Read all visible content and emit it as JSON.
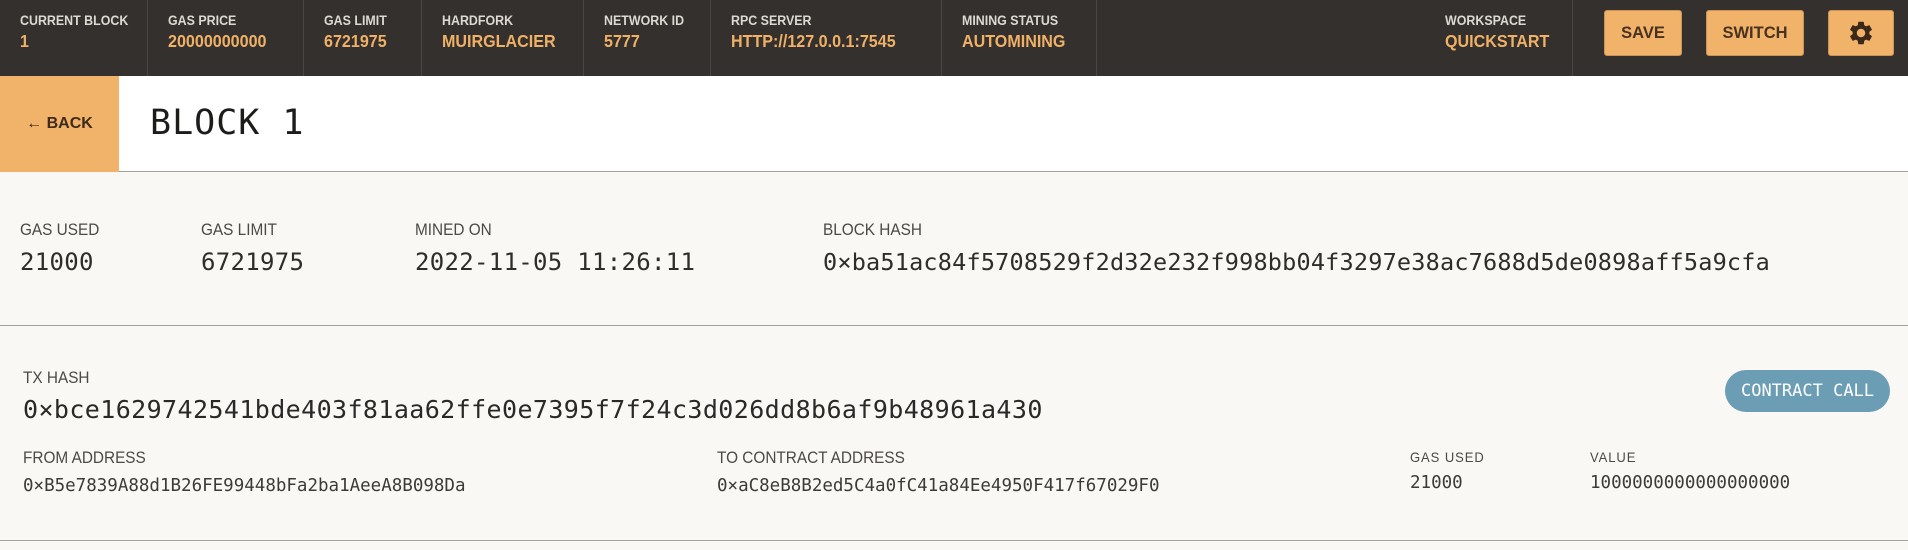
{
  "topbar": {
    "stats": [
      {
        "label": "CURRENT BLOCK",
        "value": "1"
      },
      {
        "label": "GAS PRICE",
        "value": "20000000000"
      },
      {
        "label": "GAS LIMIT",
        "value": "6721975"
      },
      {
        "label": "HARDFORK",
        "value": "MUIRGLACIER"
      },
      {
        "label": "NETWORK ID",
        "value": "5777"
      },
      {
        "label": "RPC SERVER",
        "value": "HTTP://127.0.0.1:7545"
      },
      {
        "label": "MINING STATUS",
        "value": "AUTOMINING"
      }
    ],
    "workspace": {
      "label": "WORKSPACE",
      "value": "QUICKSTART"
    },
    "save_label": "SAVE",
    "switch_label": "SWITCH",
    "settings_icon": "gear-icon"
  },
  "header": {
    "back_label": "← BACK",
    "title": "BLOCK 1"
  },
  "block": {
    "gas_used": {
      "label": "GAS USED",
      "value": "21000"
    },
    "gas_limit": {
      "label": "GAS LIMIT",
      "value": "6721975"
    },
    "mined_on": {
      "label": "MINED ON",
      "value": "2022-11-05 11:26:11"
    },
    "block_hash": {
      "label": "BLOCK HASH",
      "value": "0×ba51ac84f5708529f2d32e232f998bb04f3297e38ac7688d5de0898aff5a9cfa"
    }
  },
  "transaction": {
    "tx_hash_label": "TX HASH",
    "tx_hash": "0×bce1629742541bde403f81aa62ffe0e7395f7f24c3d026dd8b6af9b48961a430",
    "type_badge": "CONTRACT CALL",
    "from": {
      "label": "FROM ADDRESS",
      "value": "0×B5e7839A88d1B26FE99448bFa2ba1AeeA8B098Da"
    },
    "to": {
      "label": "TO CONTRACT ADDRESS",
      "value": "0×aC8eB8B2ed5C4a0fC41a84Ee4950F417f67029F0"
    },
    "gas_used": {
      "label": "GAS USED",
      "value": "21000"
    },
    "value": {
      "label": "VALUE",
      "value": "1000000000000000000"
    }
  },
  "colors": {
    "topbar_bg": "#33302d",
    "accent": "#f1b26a",
    "badge": "#6b9db4"
  }
}
